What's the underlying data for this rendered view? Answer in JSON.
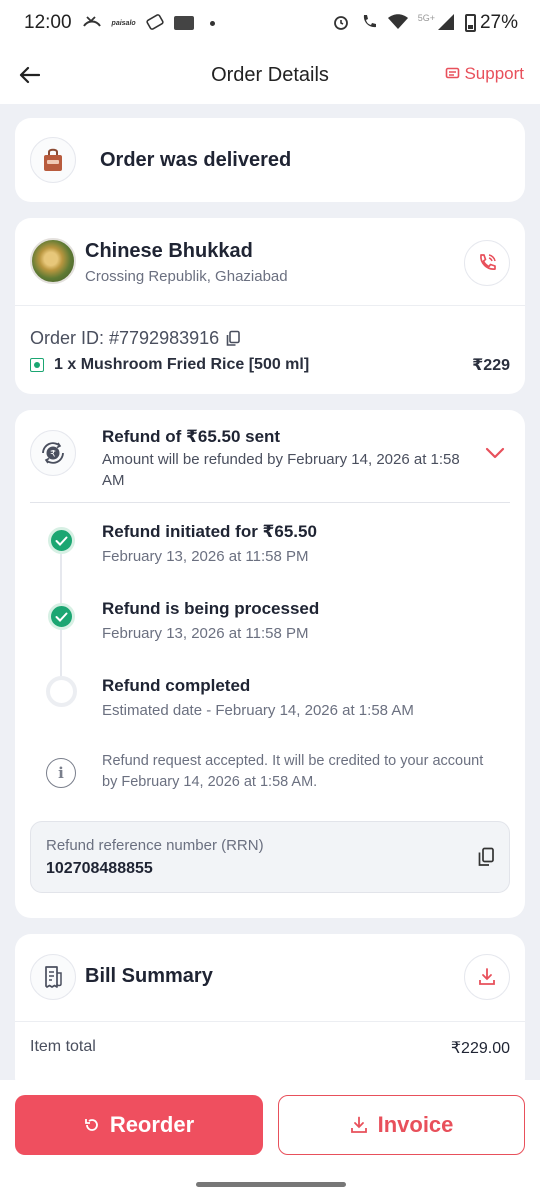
{
  "status_bar": {
    "time": "12:00",
    "network": "5G+",
    "battery": "27%",
    "notif_label": "paisalo"
  },
  "header": {
    "title": "Order Details",
    "support": "Support"
  },
  "delivery": {
    "status": "Order was delivered"
  },
  "restaurant": {
    "name": "Chinese Bhukkad",
    "location": "Crossing Republik, Ghaziabad"
  },
  "order": {
    "id_label": "Order ID: #7792983916",
    "item": "1 x Mushroom Fried Rice [500 ml]",
    "item_price": "₹229"
  },
  "refund": {
    "title": "Refund of ₹65.50 sent",
    "subtitle": "Amount will be refunded by February 14, 2026 at 1:58 AM",
    "steps": [
      {
        "title": "Refund initiated for ₹65.50",
        "date": "February 13, 2026 at 11:58 PM",
        "done": true
      },
      {
        "title": "Refund is being processed",
        "date": "February 13, 2026 at 11:58 PM",
        "done": true
      },
      {
        "title": "Refund completed",
        "date": "Estimated date - February 14, 2026 at 1:58 AM",
        "done": false
      }
    ],
    "info": "Refund request accepted. It will be credited to your account by February 14, 2026 at 1:58 AM.",
    "rrn_label": "Refund reference number (RRN)",
    "rrn_value": "102708488855"
  },
  "bill": {
    "title": "Bill Summary",
    "rows": [
      {
        "label": "Item total",
        "amount": "₹229.00"
      }
    ]
  },
  "actions": {
    "reorder": "Reorder",
    "invoice": "Invoice"
  },
  "colors": {
    "accent": "#e8505b",
    "success": "#1ba672",
    "background": "#eef0f5"
  }
}
